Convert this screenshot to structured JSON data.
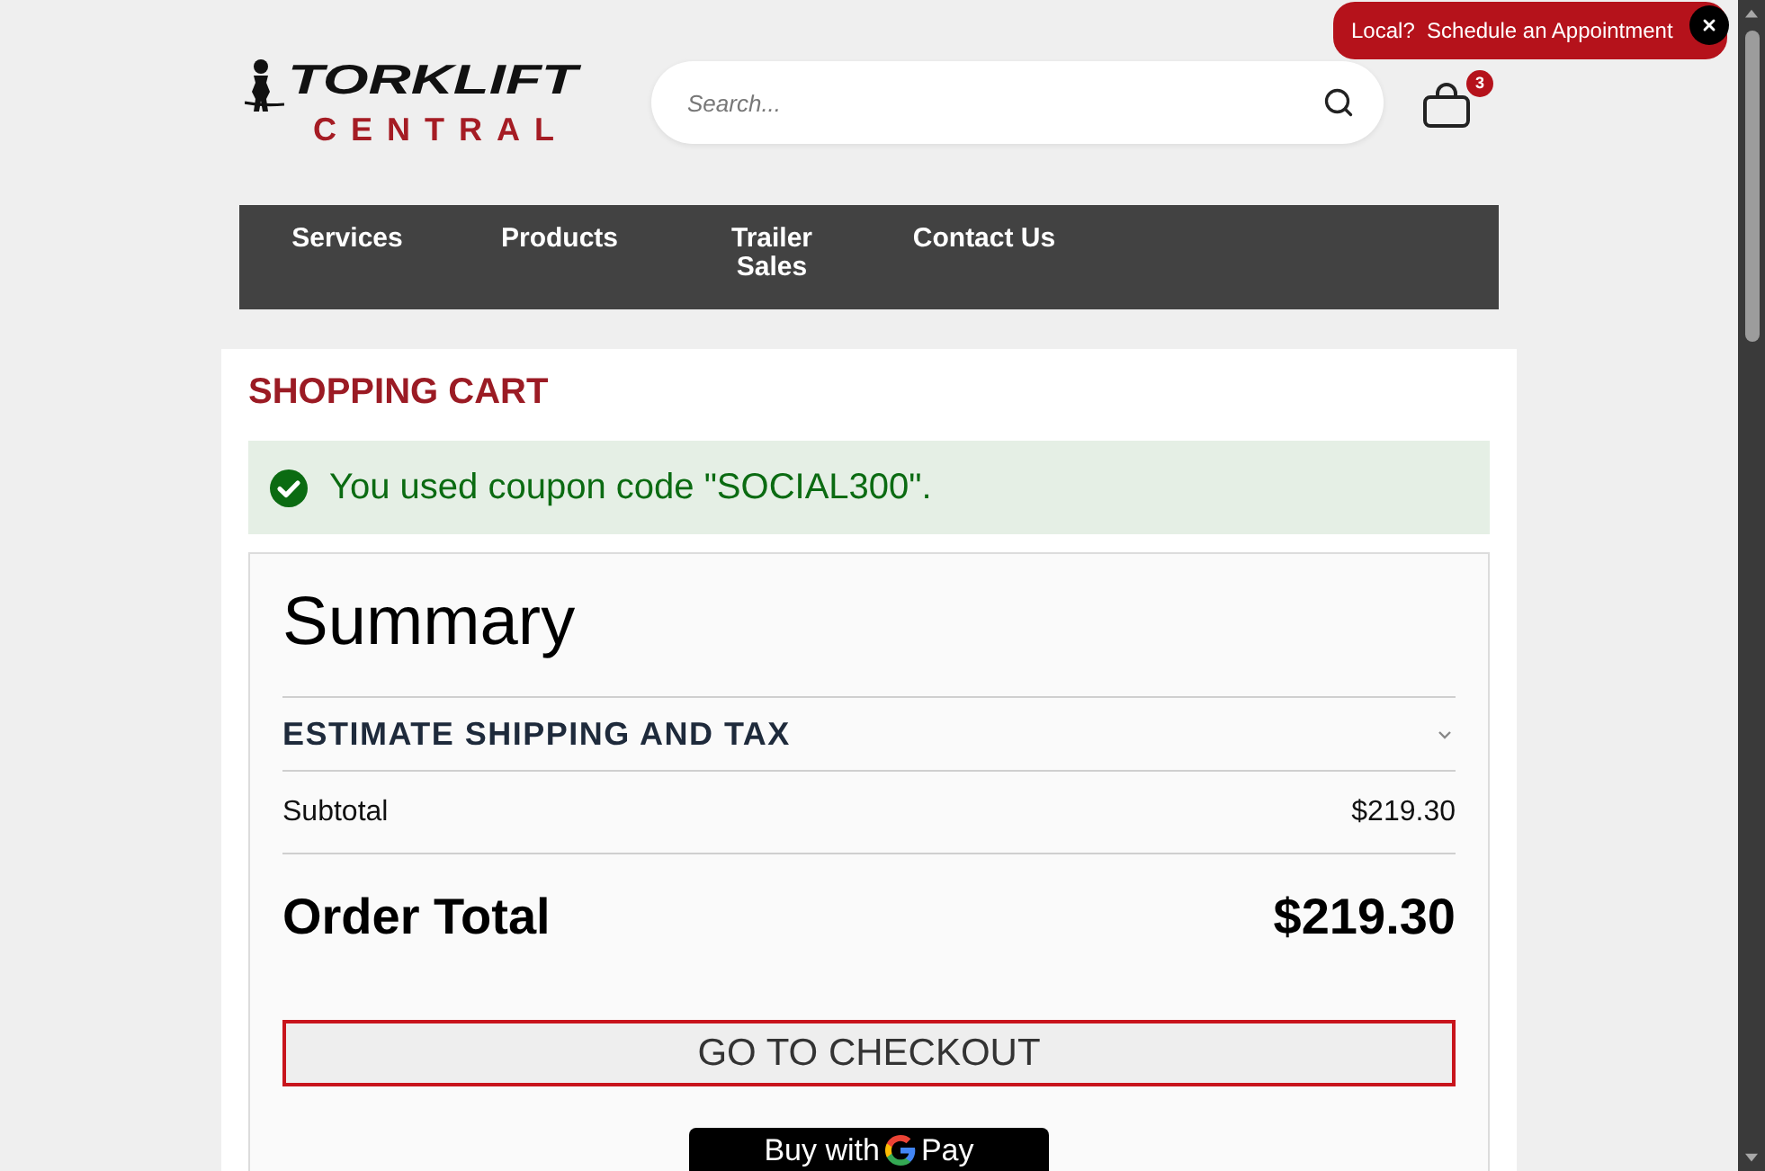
{
  "appointment_banner": {
    "text": "Local?  Schedule an Appointment"
  },
  "header": {
    "logo": {
      "line_1": "TORKLIFT",
      "line_2": "CENTRAL"
    },
    "search": {
      "placeholder": "Search..."
    },
    "cart": {
      "count": "3"
    }
  },
  "nav": [
    {
      "label": "Services"
    },
    {
      "label": "Products"
    },
    {
      "label": "Trailer Sales"
    },
    {
      "label": "Contact Us"
    }
  ],
  "cart_page": {
    "title": "SHOPPING CART",
    "message": {
      "kind": "success",
      "text": "You used coupon code \"SOCIAL300\"."
    },
    "summary": {
      "title": "Summary",
      "estimate_section": {
        "label": "ESTIMATE SHIPPING AND TAX",
        "expanded": false
      },
      "subtotal": {
        "label": "Subtotal",
        "value": "$219.30"
      },
      "order_total": {
        "label": "Order Total",
        "value": "$219.30"
      },
      "checkout_button": "GO TO CHECKOUT",
      "gpay_button": {
        "text_1": "Buy with",
        "text_2": "Pay"
      }
    }
  }
}
